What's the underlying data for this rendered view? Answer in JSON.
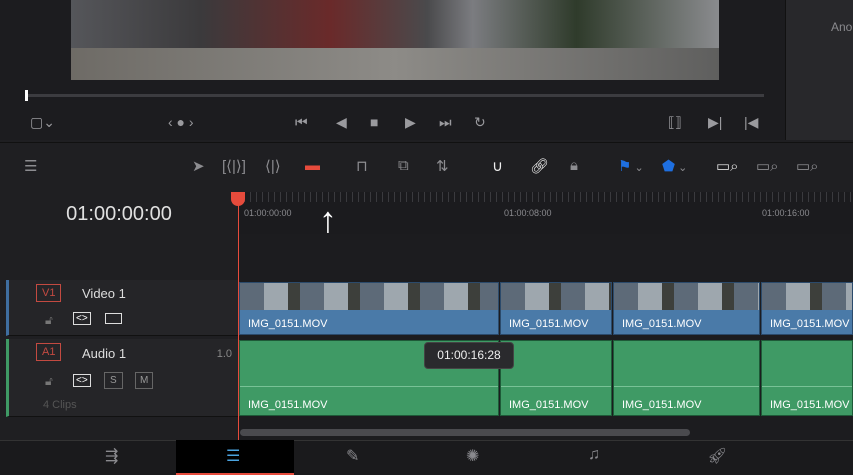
{
  "right_panel": {
    "partial_label": "Ano"
  },
  "timeline": {
    "timecode": "01:00:00:00",
    "ruler_ticks": [
      "01:00:00:00",
      "01:00:08:00",
      "01:00:16:00"
    ],
    "tooltip": "01:00:16:28"
  },
  "tracks": {
    "video": {
      "tag": "V1",
      "name": "Video 1"
    },
    "audio": {
      "tag": "A1",
      "name": "Audio 1",
      "volume": "1.0",
      "solo": "S",
      "mute": "M",
      "clip_count": "4 Clips"
    }
  },
  "clips": {
    "video": [
      "IMG_0151.MOV",
      "IMG_0151.MOV",
      "IMG_0151.MOV",
      "IMG_0151.MOV"
    ],
    "audio": [
      "IMG_0151.MOV",
      "IMG_0151.MOV",
      "IMG_0151.MOV",
      "IMG_0151.MOV"
    ]
  },
  "colors": {
    "accent": "#e64b3c",
    "video_clip": "#4a7aa8",
    "audio_clip": "#3f9a65",
    "flag": "#1e6fe0"
  }
}
